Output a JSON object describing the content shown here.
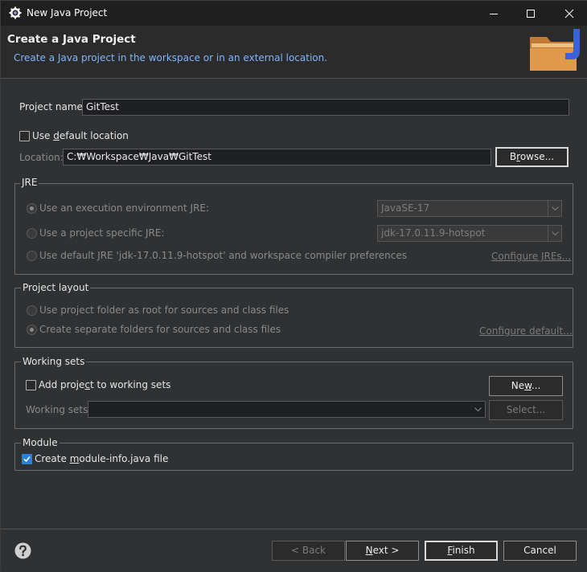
{
  "window": {
    "title": "New Java Project"
  },
  "header": {
    "title": "Create a Java Project",
    "subtitle": "Create a Java project in the workspace or in an external location."
  },
  "project": {
    "name_label": "Project name:",
    "name_value": "GitTest",
    "use_default_prefix": "Use ",
    "use_default_u": "d",
    "use_default_suffix": "efault location",
    "location_label": "Location:",
    "location_value": "C:₩Workspace₩Java₩GitTest",
    "browse_prefix": "B",
    "browse_u": "r",
    "browse_suffix": "owse..."
  },
  "jre": {
    "group_title": "JRE",
    "opt_env": "Use an execution environment JRE:",
    "opt_env_value": "JavaSE-17",
    "opt_specific": "Use a project specific JRE:",
    "opt_specific_value": "jdk-17.0.11.9-hotspot",
    "opt_default": "Use default JRE 'jdk-17.0.11.9-hotspot' and workspace compiler preferences",
    "configure_link": "Configure JREs..."
  },
  "layout": {
    "group_title": "Project layout",
    "opt_root": "Use project folder as root for sources and class files",
    "opt_separate": "Create separate folders for sources and class files",
    "configure_link": "Configure default..."
  },
  "working_sets": {
    "group_title": "Working sets",
    "add_prefix": "Add proje",
    "add_u": "c",
    "add_suffix": "t to working sets",
    "new_prefix": "Ne",
    "new_u": "w",
    "new_suffix": "...",
    "label": "Working sets:",
    "select_label": "Select..."
  },
  "module": {
    "group_title": "Module",
    "create_prefix": "Create ",
    "create_u": "m",
    "create_suffix": "odule-info.java file"
  },
  "footer": {
    "back": "< Back",
    "next_u": "N",
    "next_suffix": "ext >",
    "finish_u": "F",
    "finish_suffix": "inish",
    "cancel": "Cancel"
  },
  "colors": {
    "accent": "#2a7fe0",
    "subtitle": "#7fb4ff",
    "folder": "#d08a3e"
  }
}
